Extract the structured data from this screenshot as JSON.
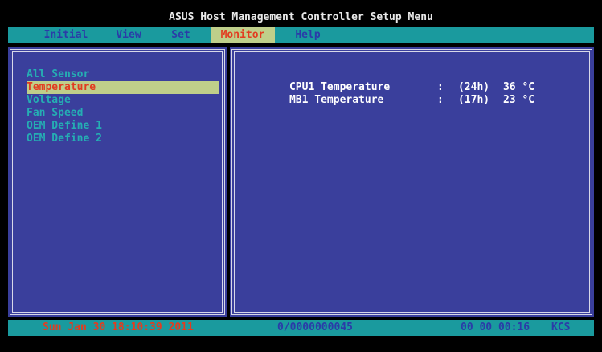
{
  "title": "ASUS Host Management Controller Setup Menu",
  "menu": [
    {
      "label": "Initial",
      "active": false
    },
    {
      "label": "View",
      "active": false
    },
    {
      "label": "Set",
      "active": false
    },
    {
      "label": "Monitor",
      "active": true
    },
    {
      "label": "Help",
      "active": false
    }
  ],
  "sensor_menu": [
    {
      "label": "All Sensor",
      "selected": false
    },
    {
      "label": "Temperature",
      "selected": true
    },
    {
      "label": "Voltage",
      "selected": false
    },
    {
      "label": "Fan Speed",
      "selected": false
    },
    {
      "label": "OEM Define 1",
      "selected": false
    },
    {
      "label": "OEM Define 2",
      "selected": false
    }
  ],
  "readings": [
    {
      "name": "CPU1 Temperature",
      "separator": ":",
      "age": "(24h)",
      "value": "36 °C"
    },
    {
      "name": "MB1 Temperature",
      "separator": ":",
      "age": "(17h)",
      "value": "23 °C"
    }
  ],
  "status": {
    "datetime": "Sun Jan 30 18:10:39 2011",
    "counter": "0/0000000045",
    "uptime": "00 00 00:16",
    "interface": "KCS"
  },
  "colors": {
    "background": "#000000",
    "menu_bar": "#1a9a9e",
    "panel": "#3a3f9c",
    "highlight": "#bfcf8a",
    "highlight_text": "#e23c20",
    "menu_text": "#2b3ba8",
    "list_text": "#25aeb3"
  }
}
